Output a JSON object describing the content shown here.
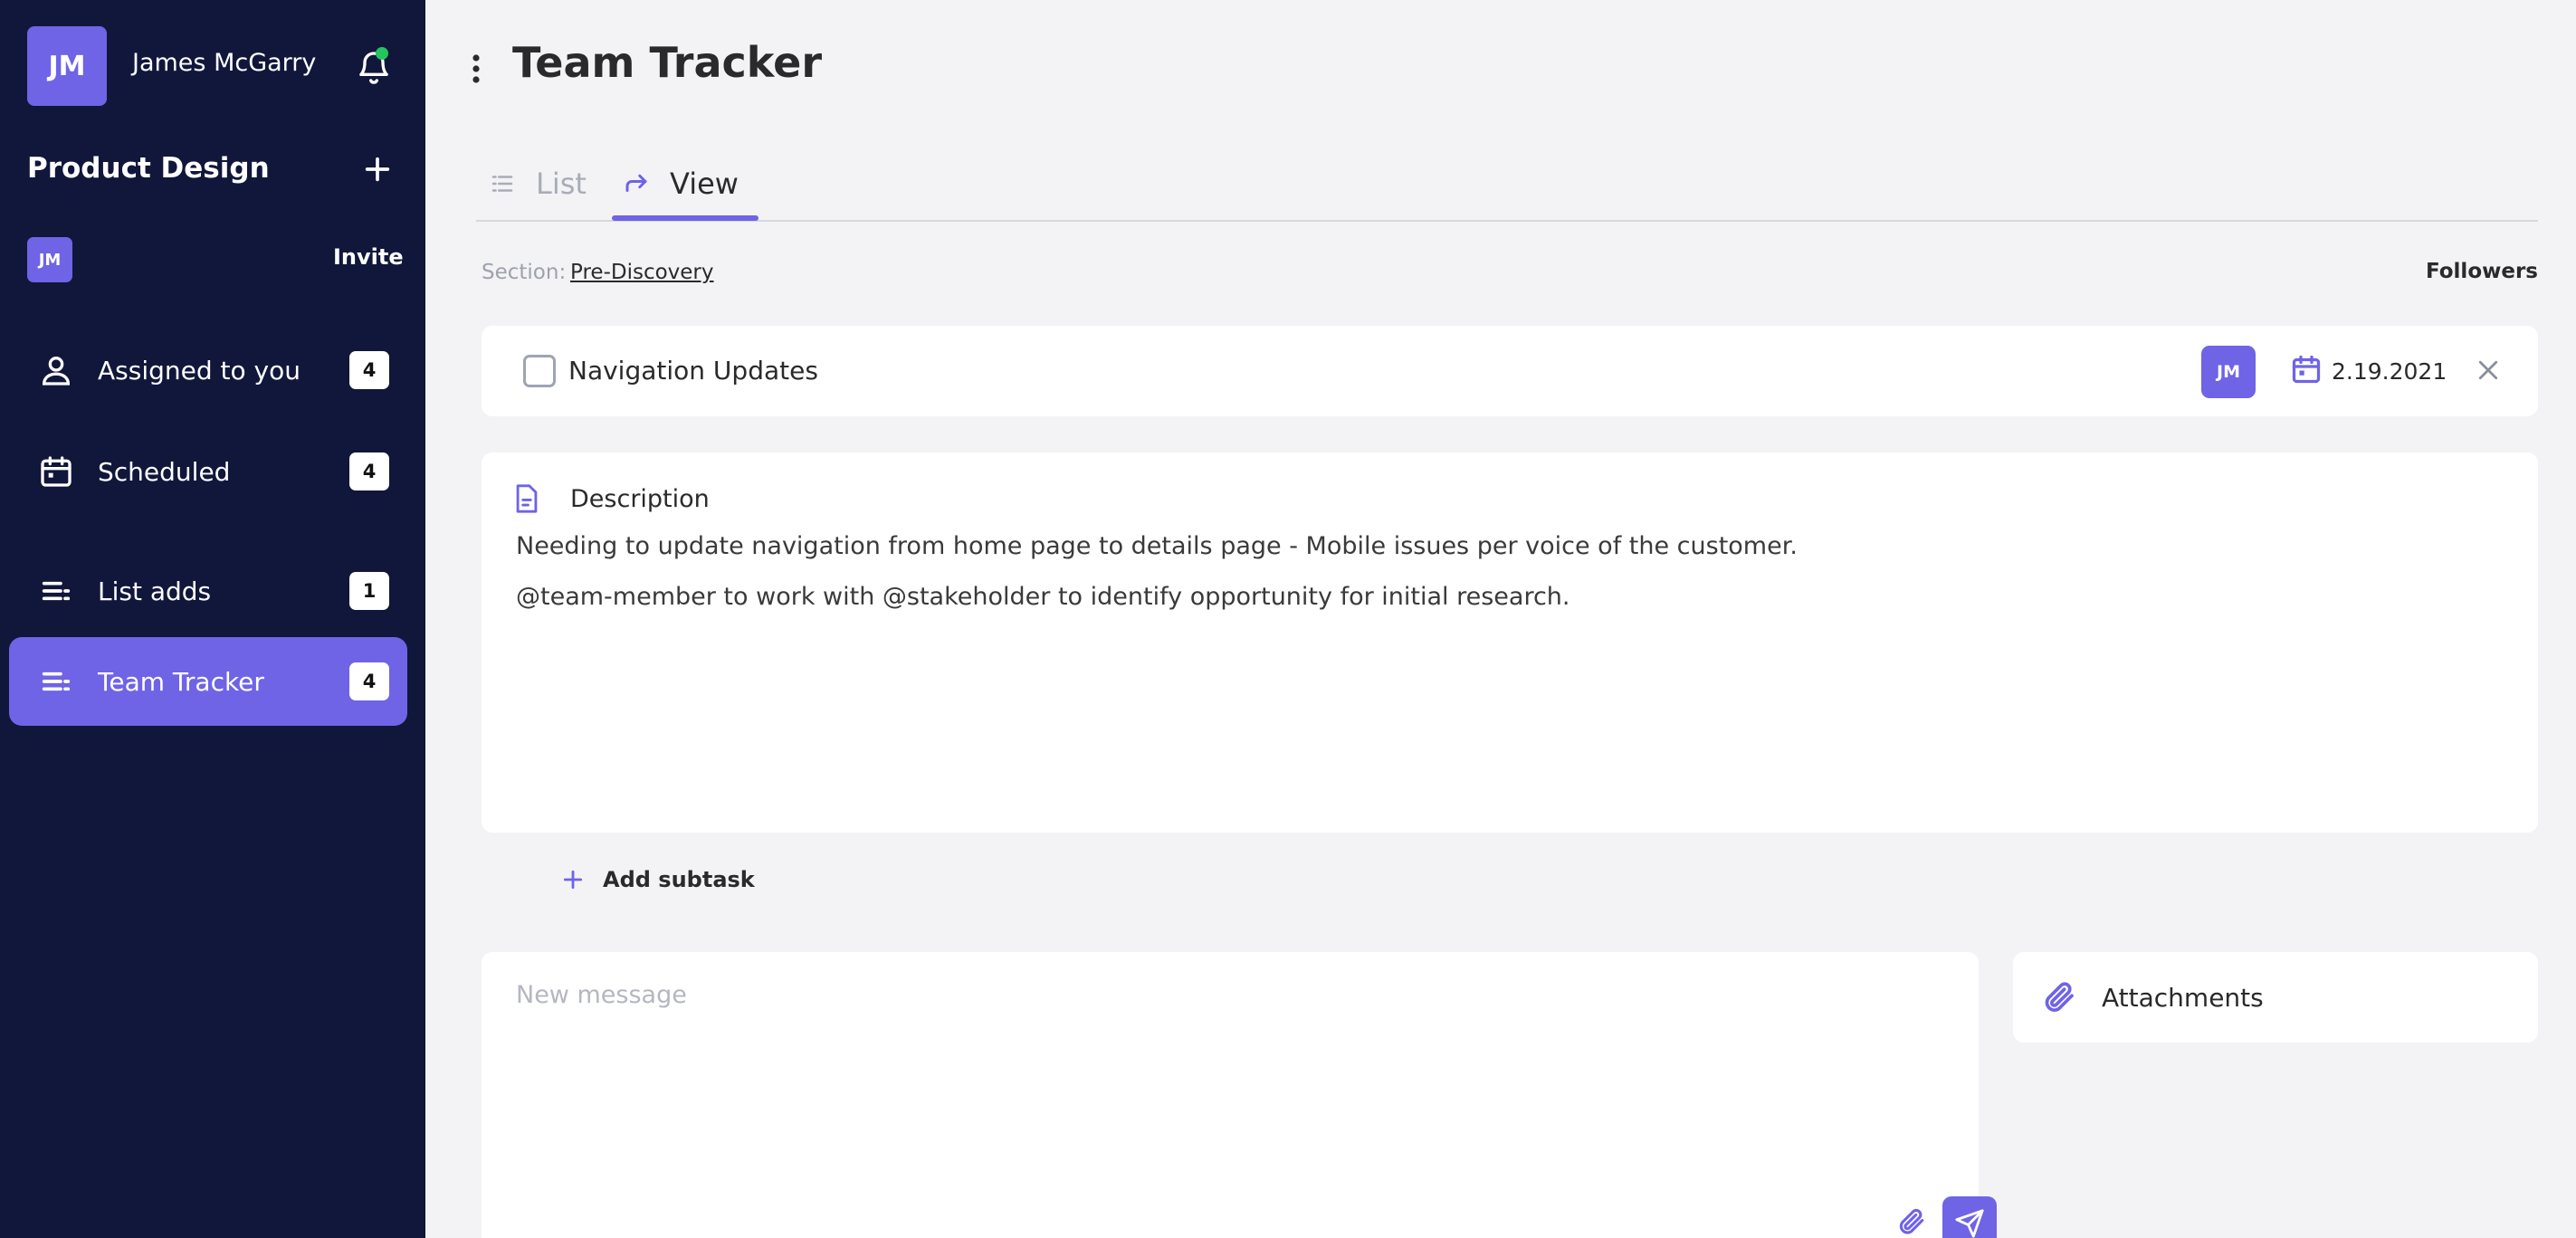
{
  "user": {
    "initials": "JM",
    "name": "James McGarry"
  },
  "project": {
    "title": "Product Design",
    "member_initials": "JM",
    "invite_label": "Invite"
  },
  "nav": [
    {
      "label": "Assigned to you",
      "count": "4",
      "icon": "person-icon"
    },
    {
      "label": "Scheduled",
      "count": "4",
      "icon": "calendar-icon"
    },
    {
      "label": "List adds",
      "count": "1",
      "icon": "list-icon"
    },
    {
      "label": "Team Tracker",
      "count": "4",
      "icon": "list-icon",
      "active": true
    }
  ],
  "page": {
    "title": "Team Tracker"
  },
  "tabs": [
    {
      "label": "List",
      "icon": "list-icon"
    },
    {
      "label": "View",
      "icon": "share-arrow-icon",
      "active": true
    }
  ],
  "section": {
    "label": "Section:",
    "value": "Pre-Discovery",
    "followers_label": "Followers"
  },
  "task": {
    "name": "Navigation Updates",
    "assignee_initials": "JM",
    "date": "2.19.2021"
  },
  "description": {
    "title": "Description",
    "lines": [
      "Needing to update navigation from home page to details page - Mobile issues per voice of the customer.",
      "@team-member to work with @stakeholder to identify opportunity for initial research."
    ]
  },
  "subtask": {
    "label": "Add subtask"
  },
  "message": {
    "placeholder": "New message",
    "value": ""
  },
  "attachments": {
    "label": "Attachments"
  },
  "colors": {
    "accent": "#6f63e6",
    "sidebar": "#11163b",
    "online": "#22c55e",
    "background": "#f3f3f5"
  }
}
